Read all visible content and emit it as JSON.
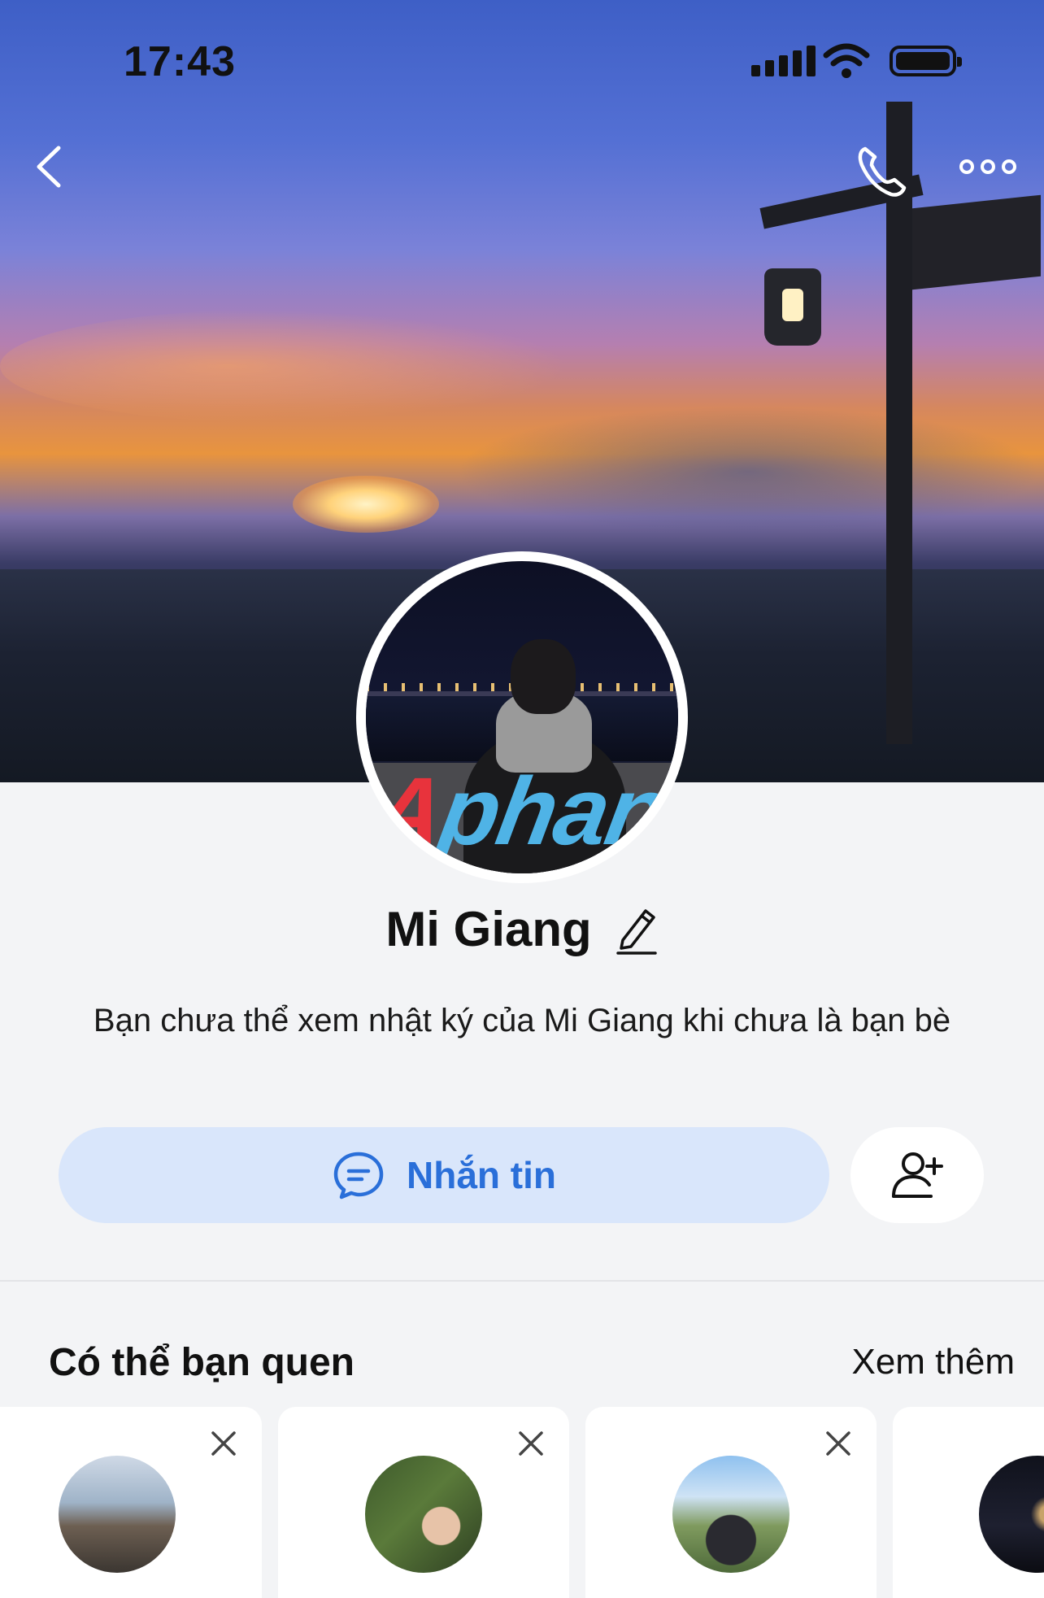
{
  "status_bar": {
    "time": "17:43"
  },
  "profile": {
    "name": "Mi Giang",
    "description": "Bạn chưa thể xem nhật ký của Mi Giang khi chưa là bạn bè",
    "avatar_watermark_red": "A",
    "avatar_watermark_blue": "phang"
  },
  "actions": {
    "message_label": "Nhắn tin"
  },
  "suggestions": {
    "title": "Có thể bạn quen",
    "see_more": "Xem thêm",
    "accent_color": "#2a6fd9"
  },
  "icons": [
    "back-icon",
    "phone-icon",
    "more-icon",
    "pencil-icon",
    "chat-bubble-icon",
    "add-friend-icon",
    "close-icon"
  ]
}
